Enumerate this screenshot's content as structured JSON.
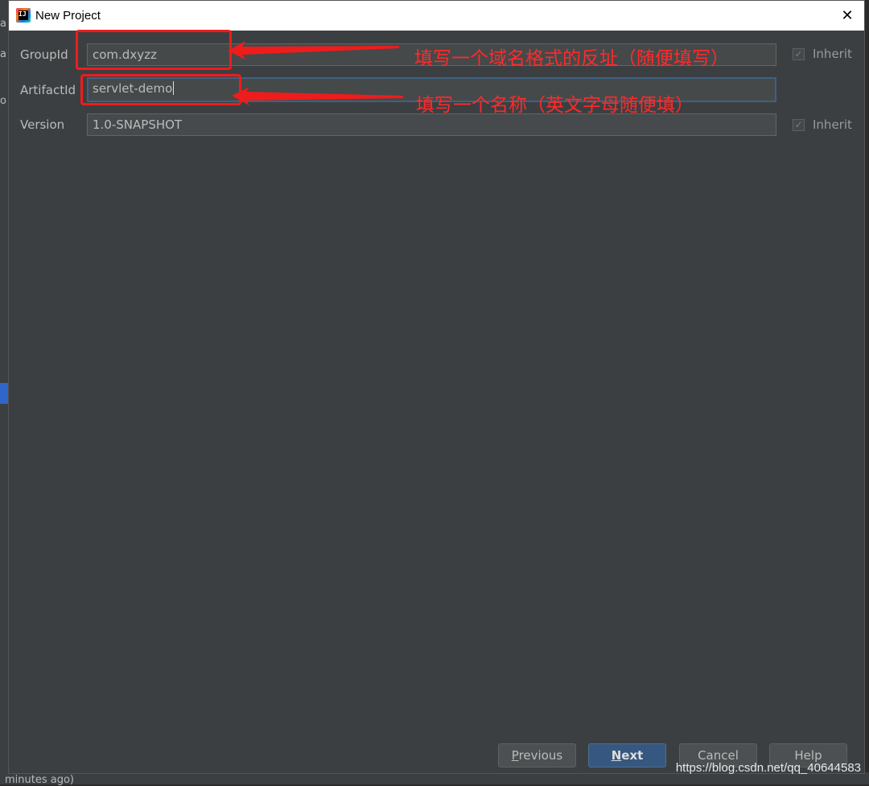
{
  "background": {
    "fragment_a": "a",
    "fragment_o": "o",
    "status_text": "minutes ago)"
  },
  "dialog": {
    "title": "New Project",
    "close_glyph": "✕"
  },
  "form": {
    "group_id": {
      "label": "GroupId",
      "value": "com.dxyzz",
      "inherit_label": "Inherit",
      "inherit_checked": true
    },
    "artifact_id": {
      "label": "ArtifactId",
      "value": "servlet-demo"
    },
    "version": {
      "label": "Version",
      "value": "1.0-SNAPSHOT",
      "inherit_label": "Inherit",
      "inherit_checked": true
    }
  },
  "annotations": {
    "group_note": "填写一个域名格式的反址（随便填写）",
    "artifact_note": "填写一个名称（英文字母随便填）",
    "color": "#ff2a2a"
  },
  "buttons": {
    "previous": {
      "mnemonic": "P",
      "rest": "revious"
    },
    "next": {
      "mnemonic": "N",
      "rest": "ext"
    },
    "cancel": "Cancel",
    "help": "Help"
  },
  "watermark": "https://blog.csdn.net/qq_40644583",
  "colors": {
    "dialog_bg": "#3c3f41",
    "field_bg": "#45494a",
    "primary_button": "#365880",
    "focus_border": "#3d6185"
  },
  "icons": {
    "app": "intellij-idea-icon",
    "close": "close-icon",
    "check": "checkmark-icon"
  }
}
